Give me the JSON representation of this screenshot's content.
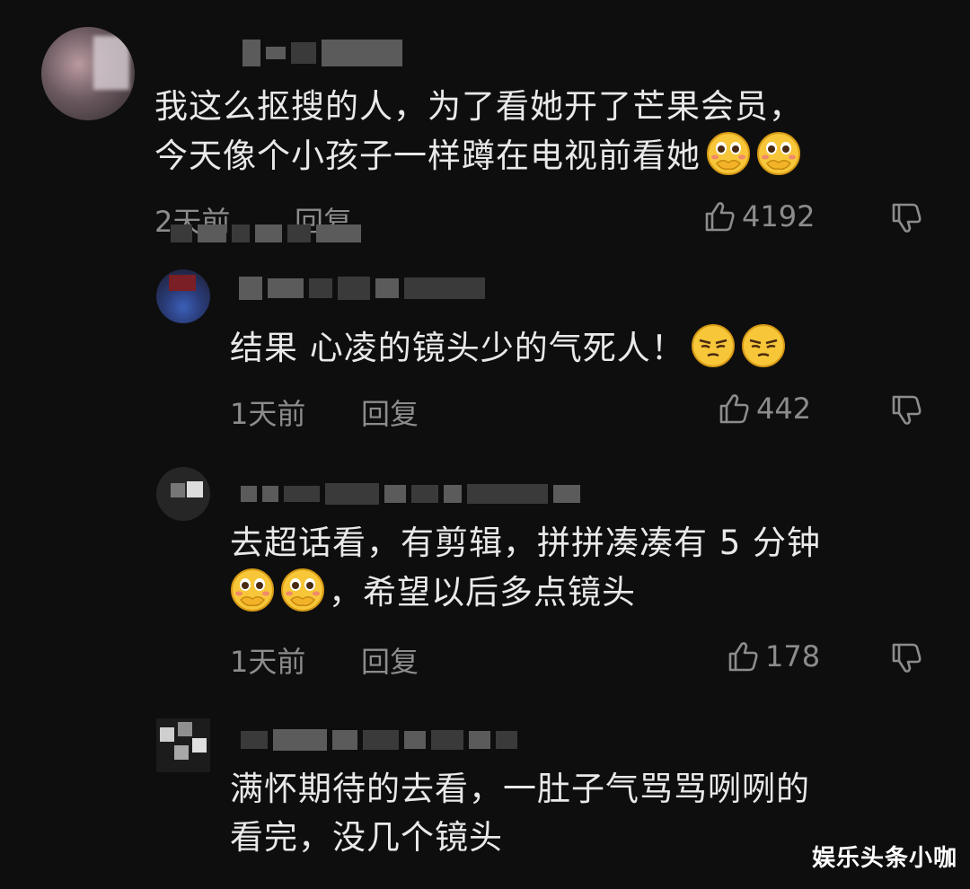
{
  "comments": [
    {
      "text_lines": [
        "我这么抠搜的人，为了看她开了芒果会员，",
        "今天像个小孩子一样蹲在电视前看她"
      ],
      "emojis": [
        "flushed-hands-emoji",
        "flushed-hands-emoji"
      ],
      "time": "2天前",
      "reply_label": "回复",
      "likes": "4192"
    },
    {
      "text_lines": [
        "结果 心凌的镜头少的气死人！"
      ],
      "emojis": [
        "smirk-emoji",
        "smirk-emoji"
      ],
      "time": "1天前",
      "reply_label": "回复",
      "likes": "442"
    },
    {
      "text_lines": [
        "去超话看，有剪辑，拼拼凑凑有 5 分钟",
        "，希望以后多点镜头"
      ],
      "emojis": [
        "flushed-hands-emoji",
        "flushed-hands-emoji"
      ],
      "time": "1天前",
      "reply_label": "回复",
      "likes": "178"
    },
    {
      "text_lines": [
        "满怀期待的去看，一肚子气骂骂咧咧的",
        "看完，没几个镜头"
      ]
    }
  ],
  "watermark": "娱乐头条小咖",
  "icons": {
    "like": "thumbs-up-icon",
    "dislike": "thumbs-down-icon"
  },
  "colors": {
    "background": "#0e0e0e",
    "text": "#e9e9e9",
    "muted": "#8c8c8c",
    "emoji_yellow": "#f6c233"
  }
}
